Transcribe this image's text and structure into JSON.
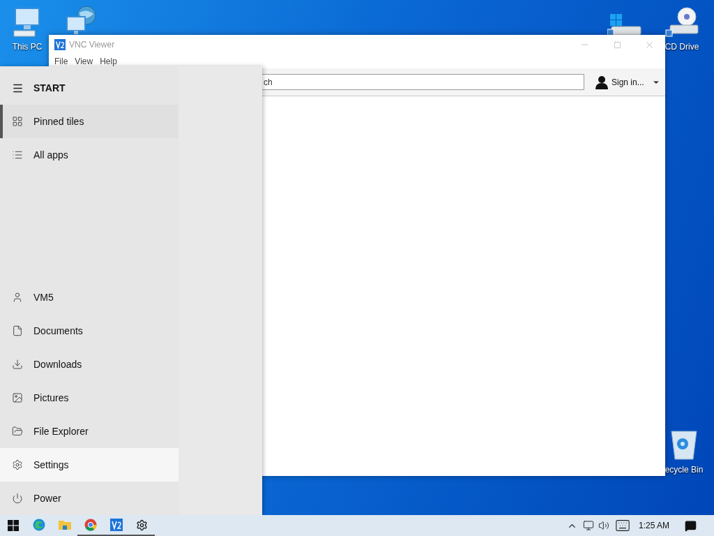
{
  "desktop_icons": [
    {
      "kind": "computer",
      "label": "This PC"
    },
    {
      "kind": "network"
    },
    {
      "kind": "drive"
    },
    {
      "kind": "disc",
      "label": "CD Drive"
    },
    {
      "kind": "recycle",
      "label": "ecycle Bin"
    }
  ],
  "vnc_window": {
    "title": "VNC Viewer",
    "menu": [
      "File",
      "View",
      "Help"
    ],
    "search": {
      "value": "ch"
    },
    "account": {
      "label": "Sign in..."
    }
  },
  "start_menu": {
    "title": "START",
    "nav": [
      {
        "kind": "tiles",
        "label": "Pinned tiles",
        "selected": true
      },
      {
        "kind": "list",
        "label": "All apps",
        "selected": false
      }
    ],
    "places": [
      {
        "kind": "user",
        "label": "VM5",
        "highlighted": false
      },
      {
        "kind": "document",
        "label": "Documents",
        "highlighted": false
      },
      {
        "kind": "download",
        "label": "Downloads",
        "highlighted": false
      },
      {
        "kind": "picture",
        "label": "Pictures",
        "highlighted": false
      },
      {
        "kind": "explorer",
        "label": "File Explorer",
        "highlighted": false
      },
      {
        "kind": "settings",
        "label": "Settings",
        "highlighted": true
      },
      {
        "kind": "power",
        "label": "Power",
        "highlighted": false
      }
    ]
  },
  "taskbar": {
    "apps": [
      {
        "kind": "edge",
        "running": false
      },
      {
        "kind": "folder",
        "running": false
      },
      {
        "kind": "chrome",
        "running": true
      },
      {
        "kind": "vnc",
        "running": true
      },
      {
        "kind": "gear",
        "running": true
      }
    ],
    "tray": {
      "time": "1:25 AM"
    }
  }
}
